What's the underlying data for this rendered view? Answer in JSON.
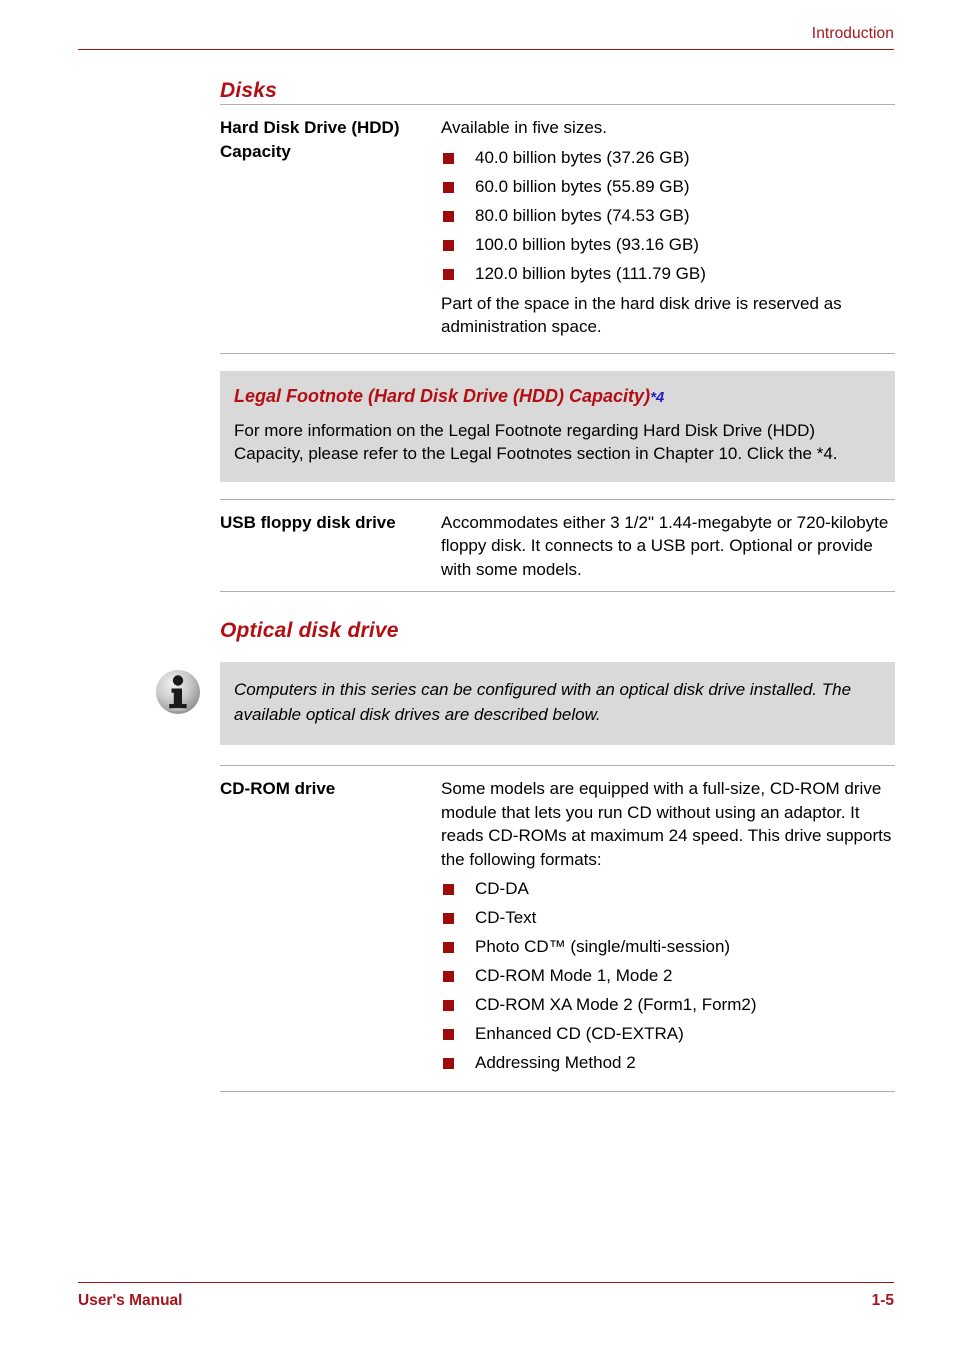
{
  "header": {
    "chapter_title": "Introduction"
  },
  "sections": {
    "disks_heading": "Disks",
    "optical_heading": "Optical disk drive"
  },
  "hdd_row": {
    "term": "Hard Disk Drive (HDD) Capacity",
    "lead": "Available in five sizes.",
    "bullets": [
      "40.0 billion bytes (37.26 GB)",
      "60.0 billion bytes (55.89 GB)",
      "80.0 billion bytes (74.53 GB)",
      "100.0 billion bytes (93.16 GB)",
      "120.0 billion bytes (111.79 GB)"
    ],
    "trail": "Part of the space in the hard disk drive is reserved as administration space."
  },
  "legal_footnote": {
    "title": "Legal Footnote (Hard Disk Drive (HDD) Capacity)",
    "reference_marker": "*4",
    "body": "For more information on the Legal Footnote regarding Hard Disk Drive (HDD) Capacity, please refer to the Legal Footnotes section in Chapter 10. Click the *4."
  },
  "usb_floppy_row": {
    "term": "USB floppy disk drive",
    "description": "Accommodates either 3 1/2\" 1.44-megabyte or 720-kilobyte floppy disk. It connects to a USB port. Optional or provide with some models."
  },
  "optical_note": {
    "icon": "info-icon",
    "text": "Computers in this series can be configured with an optical disk drive installed. The available optical disk drives are described below."
  },
  "cdrom_row": {
    "term": "CD-ROM drive",
    "lead": "Some models are equipped with a full-size, CD-ROM drive module that lets you run CD without using an adaptor. It reads CD-ROMs at maximum 24 speed. This drive supports the following formats:",
    "bullets": [
      "CD-DA",
      "CD-Text",
      "Photo CD™ (single/multi-session)",
      "CD-ROM Mode 1, Mode 2",
      "CD-ROM XA Mode 2 (Form1, Form2)",
      "Enhanced CD (CD-EXTRA)",
      "Addressing Method 2"
    ]
  },
  "footer": {
    "left": "User's Manual",
    "right": "1-5"
  },
  "colors": {
    "accent_red": "#A4161C",
    "heading_red": "#B30E13",
    "bullet_red": "#9E0B0B",
    "link_blue": "#2020C0",
    "callout_gray": "#D9D9D9",
    "rule_gray": "#B0B0B0"
  }
}
